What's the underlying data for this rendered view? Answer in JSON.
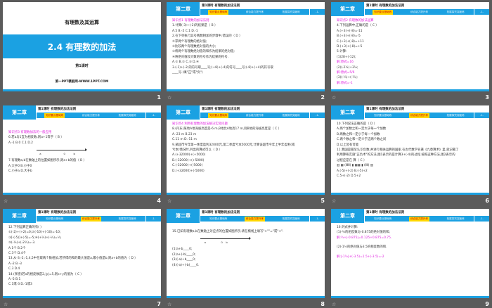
{
  "header": {
    "chapter": "第二章",
    "lesson_title": "第1课时  有理数的加法法则",
    "tabs": [
      "知识要点基础练",
      "综合能力提升练",
      "拓展探究突破练"
    ],
    "page_label": "-1-"
  },
  "title_slide": {
    "unit": "有理数及其运算",
    "title": "2.4  有理数的加法",
    "subtitle": "第1课时",
    "site": "第一PPT模板网-WWW.1PPT.COM"
  },
  "slides": [
    {
      "number": "1"
    },
    {
      "number": "2",
      "active_tab": 0,
      "lines": [
        {
          "t": "知识点1  有理数的加法法则",
          "c": "m"
        },
        {
          "t": "1.计算(-3)+(-2)的结果是（  B  ）"
        },
        {
          "t": "A.5      B.-5   C.1   D.-1"
        },
        {
          "t": "2.在下列执行异号两数相加的步骤中,错误的（  D  ）"
        },
        {
          "t": "①求两个有理数的绝对值;"
        },
        {
          "t": "②比较两个有理数绝对值的大小;"
        },
        {
          "t": "③将两个有理数绝对值的和作为结果的绝对值;"
        },
        {
          "t": "④将绝对值较大数的符号作为结果的符号."
        },
        {
          "t": "A.①     B.②   C.③  D.④"
        },
        {
          "t": "3.(-1)+(-2)的符号取____号;(+8)+(-4)的符号____号;(-8)+(+4)的符号取"
        },
        {
          "t": "____号.(填\"正\"或\"负\")"
        }
      ]
    },
    {
      "number": "3",
      "active_tab": 0,
      "lines": [
        {
          "t": "知识点2  有理数的加法运算",
          "c": "m"
        },
        {
          "t": "4.下列运算中,正确的是（  C  ）"
        },
        {
          "t": "A.(+3)+(-8)=-11"
        },
        {
          "t": "B.(+3)+(-8)=-5"
        },
        {
          "t": "C.(+3)+(-8)=+11"
        },
        {
          "t": "D.(+3)+(-8)=+5"
        },
        {
          "t": "5.计算:"
        },
        {
          "t": "(1)28+(-12);"
        },
        {
          "t": "解:原式=16",
          "c": "m"
        },
        {
          "t": "(2)(-2½)+3⅓;"
        },
        {
          "t": "解:原式=5/6",
          "c": "m"
        },
        {
          "t": "(3)(-⅓)+(-⅔);"
        },
        {
          "t": "解:原式=-1",
          "c": "m"
        }
      ]
    },
    {
      "number": "4",
      "active_tab": 0,
      "numberline": {
        "after": 4,
        "points": [
          "a",
          "0",
          "b"
        ]
      },
      "lines": [
        {
          "t": "",
          "gap": true
        },
        {
          "t": "",
          "gap": true
        },
        {
          "t": "知识点3  有理数加法的一般应用",
          "c": "m"
        },
        {
          "t": "6.若a与1互为相反数,则a+1等于（  B  ）"
        },
        {
          "t": "A.-1      B.0    C.1   D.2"
        },
        {
          "t": "7.有理数a,b在数轴上的位置如图所示,则a+b的值（  B  ）"
        },
        {
          "t": "A.大于0    B.小于0"
        },
        {
          "t": "C.小于a    D.大于b"
        }
      ]
    },
    {
      "number": "5",
      "active_tab": 0,
      "lines": [
        {
          "t": "知识点4  利用有理数的加法解决实际问题",
          "c": "m"
        },
        {
          "t": "8.(丹东)某地A地海拔高度是-6 m,B地比A地高17 m,则B地的海拔高度是（  C  ）"
        },
        {
          "t": "A.-23 m B.23 m"
        },
        {
          "t": "C.11 m  D.-11 m"
        },
        {
          "t": "9.某超市今年第一季度盈利32000元,第二季度亏本5000元,计算该超市今年上半年盈利(或"
        },
        {
          "t": "亏本)情况时,列出的算式可以（  D  ）"
        },
        {
          "t": "A.(+32000)+(+5000)"
        },
        {
          "t": "B.(-32000)+(+5000)"
        },
        {
          "t": "C.(-32000)+(-5000)"
        },
        {
          "t": "D.(+32000)+(-5000)"
        }
      ]
    },
    {
      "number": "6",
      "active_tab": 1,
      "lines": [
        {
          "t": "10.下列说法正确的是（  D  ）"
        },
        {
          "t": "A.两个加数之和一定大于每一个加数"
        },
        {
          "t": "B.两数之和一定小于每一个加数"
        },
        {
          "t": "C.两个数之和一定介于这两个数之间"
        },
        {
          "t": "D.以上皆有可能"
        },
        {
          "t": "11.我国是最早认识负数,并进行相关运算的国家.在古代数学名著《九章算术》里,就记载了"
        },
        {
          "t": "利用算筹实施\"正负术\"的方法,图1表示的是计算3+(-4)的过程.按照这种方法,图2表示的"
        },
        {
          "t": "过程应是在    算（  C  ）"
        },
        {
          "t": "▥ ▦ (⦀⦀⦀) ▮      ▦▦ ▮ (⦀⦀) ▥"
        },
        {
          "t": "A.(-5)+(-2)      B.(-5)+2"
        },
        {
          "t": "C.5+(-2)         D.5+2"
        }
      ]
    },
    {
      "number": "7",
      "active_tab": 1,
      "lines": [
        {
          "t": "12.下列运算正确的有(    )"
        },
        {
          "t": "①(-2)+(+2)=0;②(-10)+(-10)=-10;"
        },
        {
          "t": "③[-(-5)]+(-5)=-5;④(+⅔)+(-⅓)=⅓;"
        },
        {
          "t": "⑤(-⅓)+(-2⅔)=-3."
        },
        {
          "t": "A.1个              B.2个"
        },
        {
          "t": "C.3个              D.4个"
        },
        {
          "t": "13.从-3,-2,-1,4,5中任取两个数相加,若所得的和的最大值是a,最小值是b,则a+b的值为（  D  ）"
        },
        {
          "t": "A.-2     B.-3"
        },
        {
          "t": "C.3      D.4"
        },
        {
          "t": "14.(孝感)若x的相反数是2,|y|=5,则x+y的值为（  C  ）"
        },
        {
          "t": "A.-5     B.1"
        },
        {
          "t": "C.1或-3 D.-1或3"
        }
      ]
    },
    {
      "number": "8",
      "active_tab": 1,
      "numberline": {
        "after": 1,
        "points": [
          "a",
          "0",
          "b"
        ]
      },
      "lines": [
        {
          "t": "",
          "gap": true
        },
        {
          "t": "15.已知有理数a,b在数轴上对应点的位置如图所示,请在横线上填写\">\"\"=\"或\"<\"."
        },
        {
          "t": "(1)a+b____0;"
        },
        {
          "t": "(2)a+(-b)____0;"
        },
        {
          "t": "(3)(-a)+b____0;"
        },
        {
          "t": "(4)(-a)+(-b)____0."
        }
      ]
    },
    {
      "number": "9",
      "active_tab": 1,
      "lines": [
        {
          "t": "16.列式并计算:"
        },
        {
          "t": "(1)-¾的相反数与-0.875的绝对值的和;"
        },
        {
          "t": "解:¾+|-0.875|=0.125+0.875=0.75.",
          "c": "m"
        },
        {
          "t": "",
          "gap": true
        },
        {
          "t": "(2)-1½的绝对值与3.5的相反数的和."
        },
        {
          "t": "",
          "gap": true
        },
        {
          "t": "解:|-1½|+(-3.5)=1.5+(-3.5)=-2",
          "c": "m"
        }
      ]
    }
  ]
}
